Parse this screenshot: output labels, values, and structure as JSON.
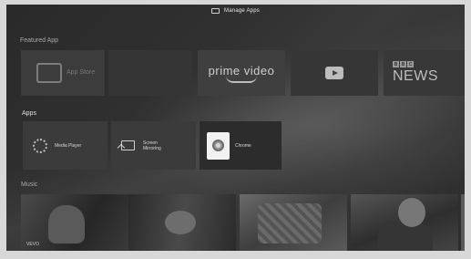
{
  "topbar": {
    "title": "Manage Apps",
    "icon": "manage-apps-icon"
  },
  "sections": {
    "featured": "Featured App",
    "apps": "Apps",
    "music": "Music"
  },
  "featured": {
    "apptile_label": "App Store",
    "prime_label": "prime video",
    "bbc_boxes": [
      "B",
      "B",
      "C"
    ],
    "bbc_news": "NEWS"
  },
  "apps": [
    {
      "name": "Media Player",
      "icon": "media-player-icon"
    },
    {
      "name": "Screen Mirroring",
      "icon": "screen-mirroring-icon"
    },
    {
      "name": "Chrome",
      "icon": "chrome-icon"
    }
  ],
  "music": {
    "first_caption": "VEVO"
  }
}
